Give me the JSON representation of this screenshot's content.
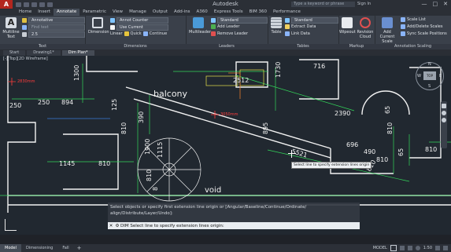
{
  "titlebar": {
    "app_letter": "A",
    "title": "Autodesk",
    "search_placeholder": "Type a keyword or phrase",
    "signin": "Sign In",
    "minimize": "—",
    "maximize": "□",
    "close": "✕"
  },
  "ribbon_tabs": [
    "Home",
    "Insert",
    "Annotate",
    "Parametric",
    "View",
    "Manage",
    "Output",
    "Add-ins",
    "A360",
    "Express Tools",
    "BIM 360",
    "Performance"
  ],
  "ribbon": {
    "text_panel": {
      "title": "Text",
      "multiline": "Multiline",
      "multiline2": "Text",
      "style": "Annotative",
      "find": "Find text",
      "height": "2.5"
    },
    "dimensions_panel": {
      "title": "Dimensions",
      "dimension": "Dimension",
      "dimstyle": "Annot Counter",
      "layer": "Use Current",
      "linear": "Linear",
      "quick": "Quick",
      "continue": "Continue"
    },
    "leaders_panel": {
      "title": "Leaders",
      "multileader": "Multileader",
      "style": "Standard",
      "add": "Add Leader",
      "remove": "Remove Leader"
    },
    "tables_panel": {
      "title": "Tables",
      "table": "Table",
      "style": "Standard",
      "extract": "Extract Data",
      "link": "Link Data"
    },
    "markup_panel": {
      "title": "Markup",
      "wipeout": "Wipeout",
      "revision": "Revision",
      "revision2": "Cloud"
    },
    "scaling_panel": {
      "title": "Annotation Scaling",
      "add_current": "Add",
      "add_current2": "Current Scale",
      "scale_list": "Scale List",
      "add_delete": "Add/Delete Scales",
      "sync": "Sync Scale Positions"
    }
  },
  "file_tabs": [
    "Start",
    "Drawing1*",
    "Dim Plan*"
  ],
  "view_label": "[-][Top][2D Wireframe]",
  "drawing": {
    "labels": {
      "balcony": "balcony",
      "void": "void"
    },
    "red_notes": [
      "2830mm",
      "3050mm"
    ],
    "dims": [
      "1300",
      "250",
      "250",
      "894",
      "2512",
      "1730",
      "716",
      "125",
      "810",
      "390",
      "895",
      "5521",
      "2390",
      "65",
      "810",
      "65",
      "810",
      "1145",
      "810",
      "1900",
      "1115",
      "810",
      "8",
      "490",
      "810",
      "696",
      "810"
    ],
    "compass": {
      "n": "N",
      "s": "S",
      "e": "E",
      "w": "W",
      "top": "TOP"
    }
  },
  "tooltip": "Select line to specify extension lines origin",
  "command": {
    "history": "Select objects or specify first extension line origin or [Angular/Baseline/Continue/Ordinate/",
    "history2": "align/Distribute/Layer/Undo]:",
    "prompt": "DIM Select line to specify extension lines origin:"
  },
  "layout_tabs": [
    "Model",
    "Dimensioning",
    "Fall"
  ],
  "status": {
    "model": "MODEL",
    "scale": "1:50"
  },
  "colors": {
    "bg": "#212830",
    "red": "#ff3c3c",
    "green": "#33d65a",
    "yellow": "#e9e24a",
    "white": "#f2f2f2"
  }
}
